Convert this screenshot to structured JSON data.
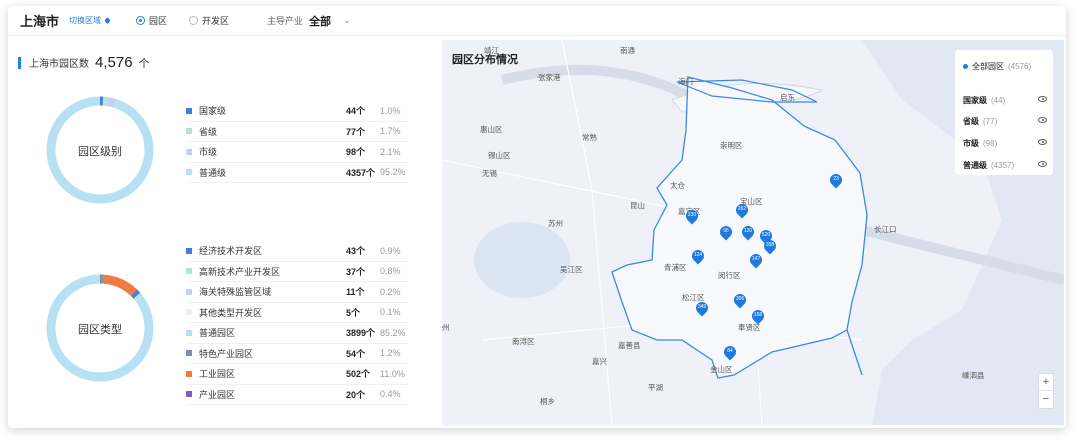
{
  "header": {
    "city": "上海市",
    "switch_label": "切换区域",
    "radio_park": "园区",
    "radio_zone": "开发区",
    "industry_label": "主导产业",
    "industry_value": "全部"
  },
  "summary": {
    "label": "上海市园区数",
    "count": "4,576",
    "unit": "个"
  },
  "level_chart": {
    "center_label": "园区级别",
    "items": [
      {
        "name": "国家级",
        "count": "44个",
        "pct": "1.0%",
        "value": 44,
        "color": "#3d7fe0"
      },
      {
        "name": "省级",
        "count": "77个",
        "pct": "1.7%",
        "value": 77,
        "color": "#b7e4d2"
      },
      {
        "name": "市级",
        "count": "98个",
        "pct": "2.1%",
        "value": 98,
        "color": "#c5cdf1"
      },
      {
        "name": "普通级",
        "count": "4357个",
        "pct": "95.2%",
        "value": 4357,
        "color": "#b8e0f5"
      }
    ]
  },
  "type_chart": {
    "center_label": "园区类型",
    "items": [
      {
        "name": "经济技术开发区",
        "count": "43个",
        "pct": "0.9%",
        "value": 43,
        "color": "#3d7fe0"
      },
      {
        "name": "高新技术产业开发区",
        "count": "37个",
        "pct": "0.8%",
        "value": 37,
        "color": "#b7e4d2"
      },
      {
        "name": "海关特殊监管区域",
        "count": "11个",
        "pct": "0.2%",
        "value": 11,
        "color": "#c5cdf1"
      },
      {
        "name": "其他类型开发区",
        "count": "5个",
        "pct": "0.1%",
        "value": 5,
        "color": "#e8eef5"
      },
      {
        "name": "普通园区",
        "count": "3899个",
        "pct": "85.2%",
        "value": 3899,
        "color": "#b8e0f5"
      },
      {
        "name": "特色产业园区",
        "count": "54个",
        "pct": "1.2%",
        "value": 54,
        "color": "#7c8fb0"
      },
      {
        "name": "工业园区",
        "count": "502个",
        "pct": "11.0%",
        "value": 502,
        "color": "#f07a43"
      },
      {
        "name": "产业园区",
        "count": "20个",
        "pct": "0.4%",
        "value": 20,
        "color": "#8a57c4"
      }
    ]
  },
  "map": {
    "title": "园区分布情况",
    "legend_all": "全部园区",
    "legend_all_count": "(4576)",
    "legend": [
      {
        "name": "国家级",
        "count": "(44)"
      },
      {
        "name": "省级",
        "count": "(77)"
      },
      {
        "name": "市级",
        "count": "(98)"
      },
      {
        "name": "普通级",
        "count": "(4357)"
      }
    ],
    "places": [
      "靖江",
      "南通",
      "张家港",
      "海门",
      "启东",
      "惠山区",
      "常熟",
      "崇明区",
      "锡山区",
      "无锡",
      "太仓",
      "宝山区",
      "昆山",
      "嘉定区",
      "苏州",
      "长江口",
      "吴江区",
      "青浦区",
      "闵行区",
      "松江区",
      "奉贤区",
      "南浔区",
      "嘉兴",
      "嘉善县",
      "平湖",
      "金山区",
      "桐乡",
      "嵊泗县",
      "州"
    ],
    "markers": [
      "23",
      "230",
      "262",
      "95",
      "130",
      "520",
      "358",
      "124",
      "147",
      "306",
      "349",
      "158",
      "84"
    ],
    "zoom_in": "+",
    "zoom_out": "−"
  }
}
